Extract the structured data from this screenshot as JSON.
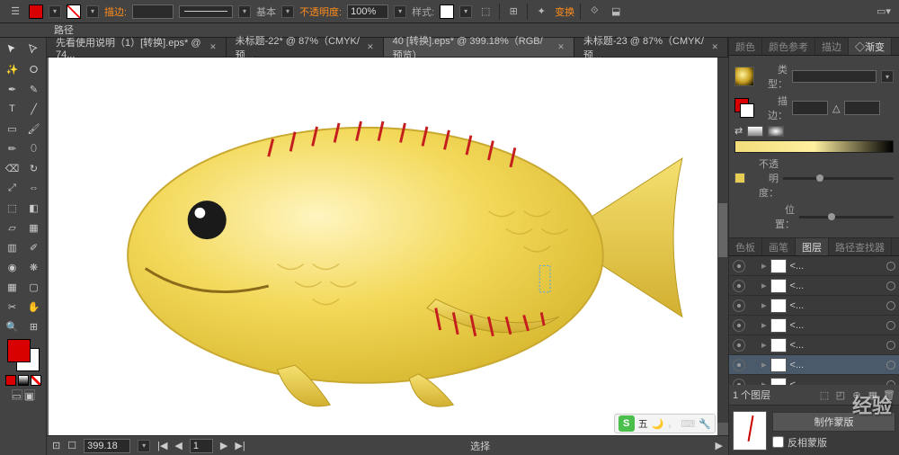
{
  "doc_label": "路径",
  "toolbar": {
    "fill": "#d90000",
    "stroke_label": "描边:",
    "opacity_label": "不透明度:",
    "opacity": "100%",
    "style_label": "样式:",
    "preset_label": "基本",
    "transform_label": "变换"
  },
  "tabs": [
    {
      "label": "先看使用说明（1）[转换].eps* @ 74...",
      "active": false
    },
    {
      "label": "未标题-22* @ 87%（CMYK/预...",
      "active": false
    },
    {
      "label": "40 [转换].eps* @ 399.18%（RGB/预览）",
      "active": true
    },
    {
      "label": "未标题-23 @ 87%（CMYK/预...",
      "active": false
    }
  ],
  "status": {
    "zoom": "399.18",
    "tool": "选择",
    "page": "1"
  },
  "ime": {
    "badge": "S",
    "text": "五"
  },
  "right": {
    "tabs_top": [
      "颜色",
      "颜色参考",
      "描边",
      "◇渐变"
    ],
    "type_label": "类型：",
    "edit_label": "描边：",
    "opacity_label": "不透明度：",
    "pos_label": "位置：",
    "layer_tabs": [
      "色板",
      "画笔",
      "图层",
      "路径查找器"
    ],
    "layers": [
      {
        "name": "<...",
        "sel": false
      },
      {
        "name": "<...",
        "sel": false
      },
      {
        "name": "<...",
        "sel": false
      },
      {
        "name": "<...",
        "sel": false
      },
      {
        "name": "<...",
        "sel": false
      },
      {
        "name": "<...",
        "sel": true
      },
      {
        "name": "<...",
        "sel": false
      }
    ],
    "layer_count": "1 个图层",
    "make_mask": "制作蒙版",
    "invert_mask": "反相蒙版"
  },
  "watermark": "经验"
}
